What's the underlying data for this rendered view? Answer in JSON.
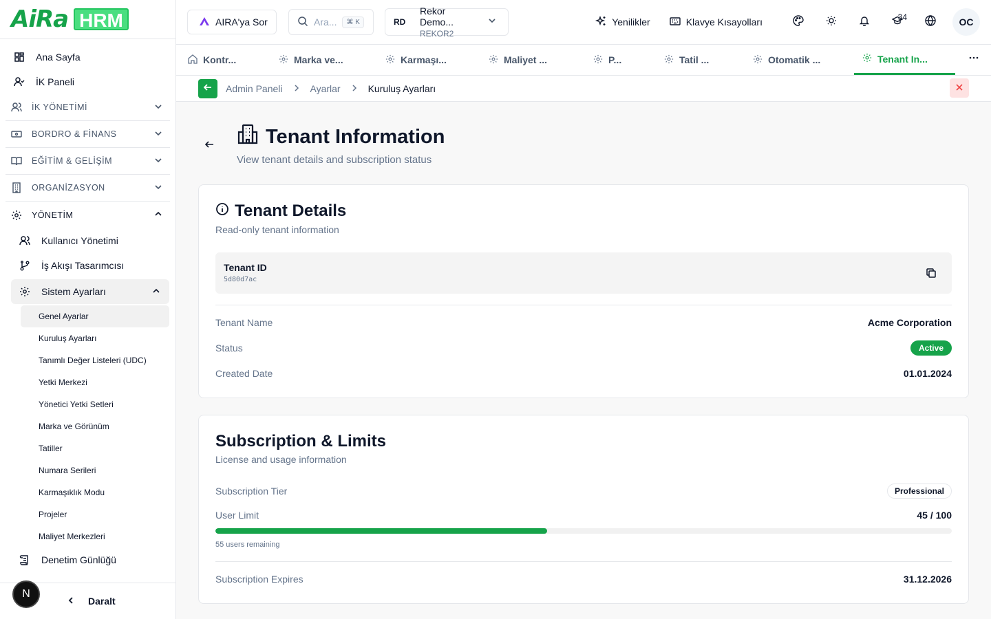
{
  "brand": {
    "name_a": "AiRa",
    "name_b": "HRM"
  },
  "sidebar": {
    "home": "Ana Sayfa",
    "hr_panel": "İK Paneli",
    "sections": [
      "İK YÖNETİMİ",
      "BORDRO & FİNANS",
      "EĞİTİM & GELİŞİM",
      "ORGANİZASYON",
      "YÖNETİM"
    ],
    "mgmt_items": [
      "Kullanıcı Yönetimi",
      "İş Akışı Tasarımcısı"
    ],
    "system_settings": "Sistem Ayarları",
    "leaves": [
      "Genel Ayarlar",
      "Kuruluş Ayarları",
      "Tanımlı Değer Listeleri (UDC)",
      "Yetki Merkezi",
      "Yönetici Yetki Setleri",
      "Marka ve Görünüm",
      "Tatiller",
      "Numara Serileri",
      "Karmaşıklık Modu",
      "Projeler",
      "Maliyet Merkezleri"
    ],
    "audit": "Denetim Günlüğü",
    "footer_badge": "N",
    "collapse": "Daralt"
  },
  "topbar": {
    "aira_btn": "AIRA'ya Sor",
    "search_placeholder": "Ara...",
    "search_kbd": "⌘ K",
    "tenant_initials": "RD",
    "tenant_name": "Rekor Demo...",
    "tenant_code": "REKOR2",
    "news": "Yenilikler",
    "shortcuts": "Klavye Kısayolları",
    "training_count": "34",
    "avatar": "OC"
  },
  "tabs": [
    "Kontr...",
    "Marka ve...",
    "Karmaşı...",
    "Maliyet ...",
    "P...",
    "Tatil ...",
    "Otomatik ...",
    "Tenant In..."
  ],
  "breadcrumb": [
    "Admin Paneli",
    "Ayarlar",
    "Kuruluş Ayarları"
  ],
  "page": {
    "title": "Tenant Information",
    "subtitle": "View tenant details and subscription status"
  },
  "details": {
    "title": "Tenant Details",
    "subtitle": "Read-only tenant information",
    "id_label": "Tenant ID",
    "id_value": "5d80d7ac",
    "name_label": "Tenant Name",
    "name_value": "Acme Corporation",
    "status_label": "Status",
    "status_value": "Active",
    "created_label": "Created Date",
    "created_value": "01.01.2024"
  },
  "subscription": {
    "title": "Subscription & Limits",
    "subtitle": "License and usage information",
    "tier_label": "Subscription Tier",
    "tier_value": "Professional",
    "limit_label": "User Limit",
    "limit_value": "45 / 100",
    "usage_fraction": 0.45,
    "remaining": "55 users remaining",
    "expires_label": "Subscription Expires",
    "expires_value": "31.12.2026"
  },
  "colors": {
    "accent": "#16a34a",
    "danger_bg": "#fee2e2",
    "danger": "#ef4444"
  }
}
